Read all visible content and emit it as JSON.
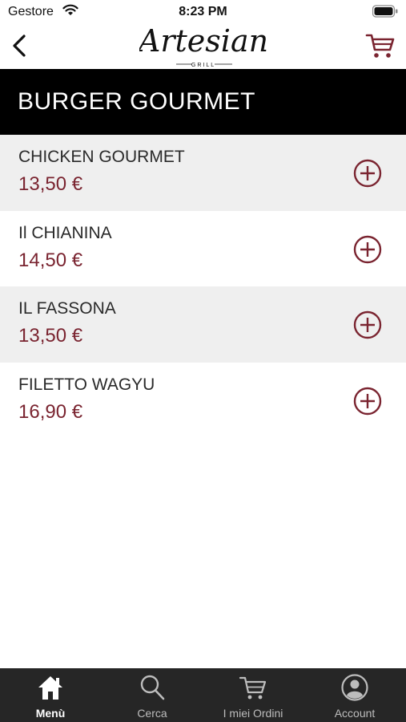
{
  "status_bar": {
    "carrier": "Gestore",
    "time": "8:23 PM"
  },
  "nav": {
    "logo_script": "Artesian",
    "logo_sub": "GRILL"
  },
  "category": {
    "title": "BURGER GOURMET"
  },
  "products": [
    {
      "name": "CHICKEN GOURMET",
      "price": "13,50 €"
    },
    {
      "name": "Il CHIANINA",
      "price": "14,50 €"
    },
    {
      "name": "IL FASSONA",
      "price": "13,50 €"
    },
    {
      "name": "FILETTO WAGYU",
      "price": "16,90 €"
    }
  ],
  "tabs": [
    {
      "label": "Menù",
      "icon": "home-icon",
      "active": true
    },
    {
      "label": "Cerca",
      "icon": "search-icon",
      "active": false
    },
    {
      "label": "I miei Ordini",
      "icon": "cart-icon",
      "active": false
    },
    {
      "label": "Account",
      "icon": "account-icon",
      "active": false
    }
  ],
  "colors": {
    "accent": "#7a2430",
    "header_bg": "#000000",
    "tab_bar_bg": "#262626",
    "row_shade": "#efefef"
  }
}
